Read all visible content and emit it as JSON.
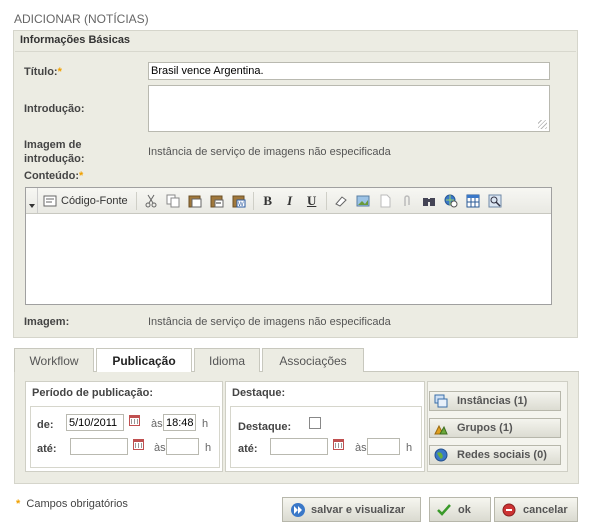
{
  "page": {
    "title": "ADICIONAR (NOTÍCIAS)"
  },
  "basic": {
    "section_title": "Informações Básicas",
    "required_mark": "*",
    "title_label": "Título:",
    "title_value": "Brasil vence Argentina.",
    "intro_label": "Introdução:",
    "intro_image_label": "Imagem de introdução:",
    "intro_image_value": "Instância de serviço de imagens não especificada",
    "content_label": "Conteúdo:",
    "image_label": "Imagem:",
    "image_value": "Instância de serviço de imagens não especificada"
  },
  "editor": {
    "toolbar": {
      "source_label": "Código-Fonte",
      "icons": [
        "cut-icon",
        "copy-icon",
        "paste-icon",
        "paste-text-icon",
        "paste-word-icon",
        "bold-icon",
        "italic-icon",
        "underline-icon",
        "eraser-icon",
        "image-icon",
        "page-icon",
        "attachment-icon",
        "find-icon",
        "link-icon",
        "table-icon",
        "preview-icon"
      ],
      "bold_label": "B",
      "italic_label": "I",
      "underline_label": "U"
    }
  },
  "tabs": [
    {
      "label": "Workflow",
      "active": false
    },
    {
      "label": "Publicação",
      "active": true
    },
    {
      "label": "Idioma",
      "active": false
    },
    {
      "label": "Associações",
      "active": false
    }
  ],
  "publication": {
    "period_title": "Período de publicação:",
    "from_label": "de:",
    "from_date": "5/10/2011",
    "at_label": "às",
    "from_time": "18:48",
    "hour_label": "h",
    "until_label": "até:",
    "until_date": "",
    "until_time": "",
    "highlight_title": "Destaque:",
    "highlight_checkbox_label": "Destaque:",
    "highlight_checked": false,
    "highlight_until_label": "até:",
    "highlight_until_date": "",
    "highlight_until_time": ""
  },
  "side_buttons": [
    {
      "label": "Instâncias (1)",
      "icon": "instances-icon"
    },
    {
      "label": "Grupos (1)",
      "icon": "groups-icon"
    },
    {
      "label": "Redes sociais (0)",
      "icon": "globe-icon"
    }
  ],
  "footer": {
    "required_note": "Campos obrigatórios",
    "save_preview_label": "salvar e visualizar",
    "ok_label": "ok",
    "cancel_label": "cancelar"
  },
  "colors": {
    "panel_bg": "#ecece3",
    "required": "#f0a000",
    "ok_green": "#3a9a2a",
    "cancel_red": "#cc3333",
    "save_blue": "#3a78c8"
  }
}
